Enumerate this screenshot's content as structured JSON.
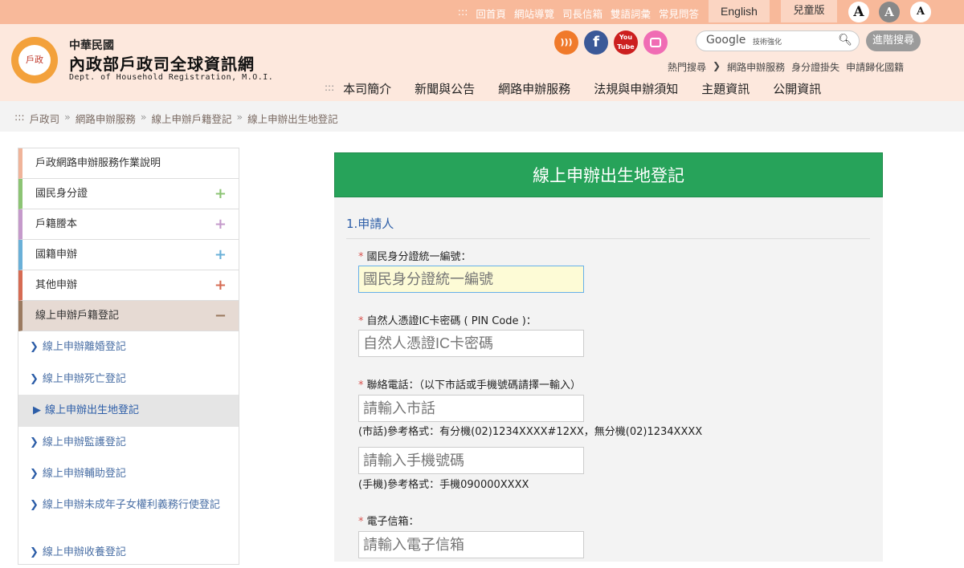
{
  "topbar": {
    "links": [
      ":::",
      "回首頁",
      "網站導覽",
      "司長信箱",
      "雙語詞彙",
      "常見問答"
    ],
    "english": "English",
    "kids": "兒童版",
    "font_btns": [
      "A",
      "A",
      "A"
    ]
  },
  "logo": {
    "line1": "中華民國",
    "line2": "內政部戶政司全球資訊網",
    "line3": "Dept. of Household Registration, M.O.I.",
    "mark": "戶政"
  },
  "social": [
    "rss",
    "f",
    "You Tube",
    "flickr"
  ],
  "search": {
    "brand": "Google",
    "sub": "技術強化",
    "advanced": "進階搜尋"
  },
  "hot": {
    "label": "熱門搜尋",
    "items": [
      "網路申辦服務",
      "身分證掛失",
      "申請歸化國籍"
    ]
  },
  "nav": [
    ":::",
    "本司簡介",
    "新聞與公告",
    "網路申辦服務",
    "法規與申辦須知",
    "主題資訊",
    "公開資訊"
  ],
  "breadcrumb": [
    ":::",
    "戶政司",
    "網路申辦服務",
    "線上申辦戶籍登記",
    "線上申辦出生地登記"
  ],
  "sidebar": {
    "items": [
      {
        "label": "戶政網路申辦服務作業說明",
        "color": "#f0b49a",
        "plus": ""
      },
      {
        "label": "國民身分證",
        "color": "#8cc474",
        "plus": "+"
      },
      {
        "label": "戶籍謄本",
        "color": "#c59acb",
        "plus": "+"
      },
      {
        "label": "國籍申辦",
        "color": "#6ab0d8",
        "plus": "+"
      },
      {
        "label": "其他申辦",
        "color": "#d66b53",
        "plus": "+"
      },
      {
        "label": "線上申辦戶籍登記",
        "color": "#9b7a60",
        "plus": "−"
      }
    ],
    "subs": [
      "線上申辦離婚登記",
      "線上申辦死亡登記",
      "線上申辦出生地登記",
      "線上申辦監護登記",
      "線上申辦輔助登記",
      "線上申辦未成年子女權利義務行使登記",
      "線上申辦收養登記"
    ]
  },
  "main": {
    "title": "線上申辦出生地登記",
    "section": "1.申請人",
    "fields": {
      "id_label": "國民身分證統一編號：",
      "id_placeholder": "國民身分證統一編號",
      "pin_label": "自然人憑證IC卡密碼 ( PIN Code )：",
      "pin_placeholder": "自然人憑證IC卡密碼",
      "phone_label": "聯絡電話：（以下市話或手機號碼請擇一輸入）",
      "tel_placeholder": "請輸入市話",
      "tel_hint": "(市話)參考格式：有分機(02)1234XXXX#12XX，無分機(02)1234XXXX",
      "mobile_placeholder": "請輸入手機號碼",
      "mobile_hint": "(手機)參考格式：手機090000XXXX",
      "email_label": "電子信箱：",
      "email_placeholder": "請輸入電子信箱"
    }
  }
}
